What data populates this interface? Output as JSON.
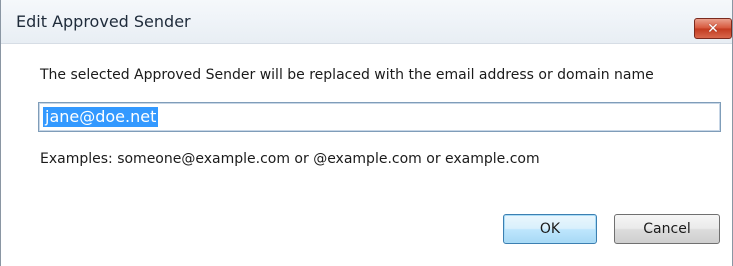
{
  "window": {
    "title": "Edit Approved Sender",
    "close_symbol": "✕"
  },
  "prompt": "The selected Approved Sender will be replaced with the email address or domain name",
  "input": {
    "value": "jane@doe.net"
  },
  "examples": "Examples:  someone@example.com or  @example.com or example.com",
  "buttons": {
    "ok": "OK",
    "cancel": "Cancel"
  },
  "colors": {
    "selection": "#3399ff",
    "close_button": "#c23a1f"
  }
}
